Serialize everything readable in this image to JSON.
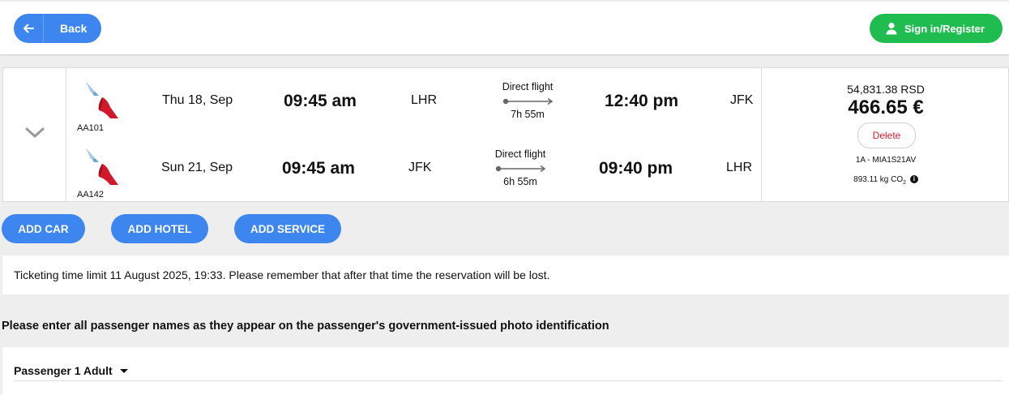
{
  "header": {
    "back_label": "Back",
    "signin_label": "Sign in/Register",
    "back_icon": "arrow-left-icon",
    "user_icon": "user-icon"
  },
  "colors": {
    "primary": "#3d86f0",
    "signin": "#1fbd4f",
    "delete_text": "#d0192a",
    "airline_red": "#d0192a",
    "airline_blue": "#6aa6cf"
  },
  "segments": [
    {
      "flight_code": "AA101",
      "date": "Thu 18, Sep",
      "depart_time": "09:45 am",
      "depart_airport": "LHR",
      "direct_label": "Direct flight",
      "duration": "7h 55m",
      "arrive_time": "12:40 pm",
      "arrive_airport": "JFK"
    },
    {
      "flight_code": "AA142",
      "date": "Sun 21, Sep",
      "depart_time": "09:45 am",
      "depart_airport": "JFK",
      "direct_label": "Direct flight",
      "duration": "6h 55m",
      "arrive_time": "09:40 pm",
      "arrive_airport": "LHR"
    }
  ],
  "price": {
    "rsd": "54,831.38 RSD",
    "eur": "466.65 €",
    "delete_label": "Delete",
    "pnr": "1A - MIA1S21AV",
    "co2_value": "893.11 kg CO",
    "co2_sub": "2",
    "info_symbol": "i"
  },
  "add_buttons": {
    "car": "ADD CAR",
    "hotel": "ADD HOTEL",
    "service": "ADD SERVICE"
  },
  "notice": "Ticketing time limit 11 August 2025, 19:33. Please remember that after that time the reservation will be lost.",
  "instruction": "Please enter all passenger names as they appear on the passenger's government-issued photo identification",
  "passenger": {
    "title": "Passenger 1 Adult"
  }
}
